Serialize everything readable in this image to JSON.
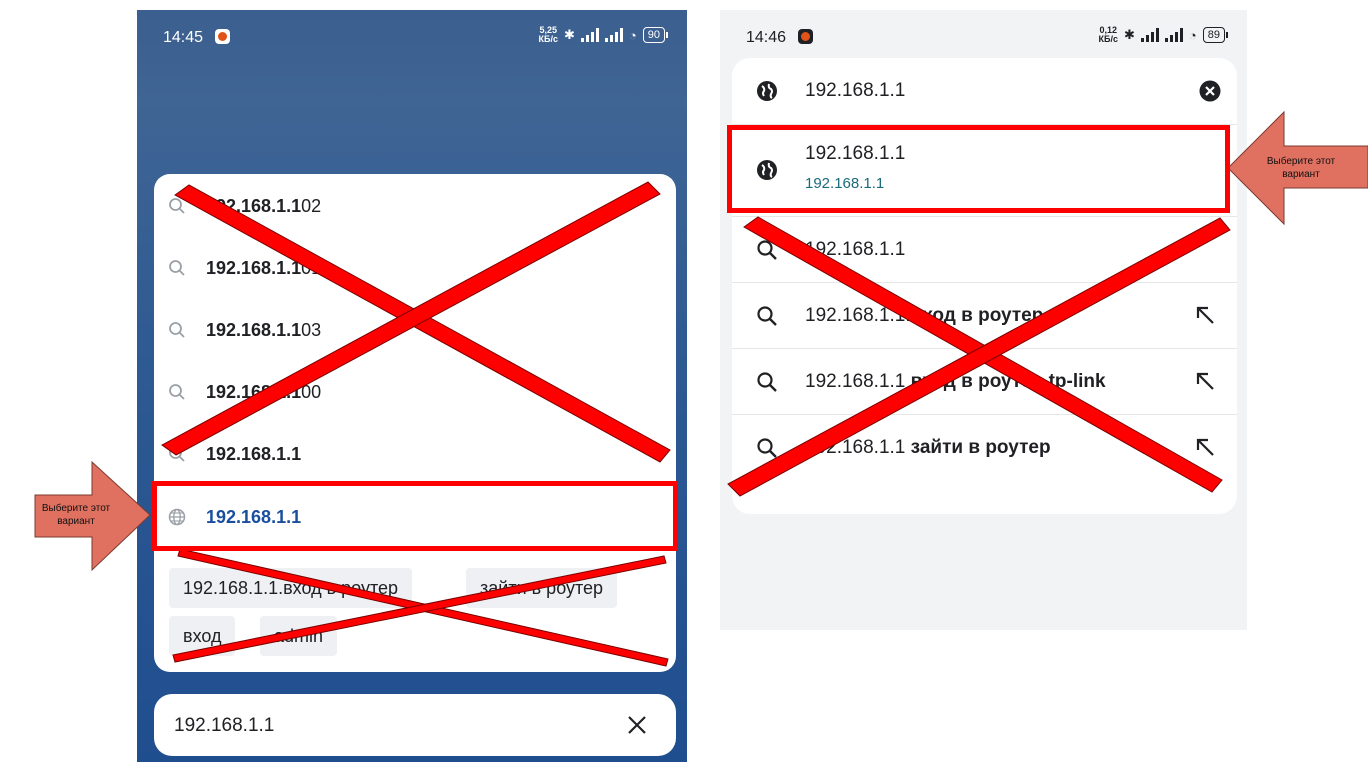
{
  "left": {
    "status": {
      "time": "14:45",
      "speed_top": "5,25",
      "speed_bottom": "КБ/с",
      "battery": "90"
    },
    "suggestions": [
      {
        "bold": "192.168.1.1",
        "rest": "02"
      },
      {
        "bold": "192.168.1.1",
        "rest": "01"
      },
      {
        "bold": "192.168.1.1",
        "rest": "03"
      },
      {
        "bold": "192.168.1.1",
        "rest": "00"
      },
      {
        "bold": "192.168.1.1",
        "rest": ""
      }
    ],
    "url_suggestion": "192.168.1.1",
    "chips": [
      "192.168.1.1.вход в роутер",
      "зайти в роутер",
      "вход",
      "admin"
    ],
    "input_value": "192.168.1.1"
  },
  "right": {
    "status": {
      "time": "14:46",
      "speed_top": "0,12",
      "speed_bottom": "КБ/с",
      "battery": "89"
    },
    "search_value": "192.168.1.1",
    "url_suggestion": {
      "title": "192.168.1.1",
      "url": "192.168.1.1"
    },
    "suggestions": [
      {
        "text": "192.168.1.1",
        "bold": ""
      },
      {
        "text": "192.168.1.1.",
        "bold": "вход в роутер"
      },
      {
        "text": "192.168.1.1 ",
        "bold": "вход в роутер tp-link"
      },
      {
        "text": "192.168.1.1 ",
        "bold": "зайти в роутер"
      }
    ]
  },
  "annotation": {
    "line1": "Выберите этот",
    "line2": "вариант"
  },
  "colors": {
    "cross": "#ff0000",
    "arrow_fill": "#e07060",
    "link_blue": "#1a4fa0",
    "url_teal": "#1a6a7a"
  }
}
